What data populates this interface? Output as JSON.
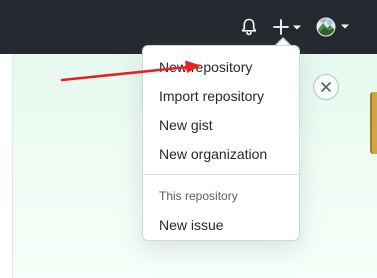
{
  "header": {
    "notifications_icon": "bell-icon",
    "create_icon": "plus-icon",
    "create_dropdown_icon": "caret-down-icon",
    "avatar_icon": "user-avatar",
    "avatar_dropdown_icon": "caret-down-icon"
  },
  "dropdown": {
    "items": [
      {
        "label": "New repository"
      },
      {
        "label": "Import repository"
      },
      {
        "label": "New gist"
      },
      {
        "label": "New organization"
      }
    ],
    "section_label": "This repository",
    "section_items": [
      {
        "label": "New issue"
      }
    ]
  },
  "banner": {
    "close_icon": "close-icon"
  },
  "annotation": {
    "arrow_color": "#e8211f",
    "points_to": "New repository"
  },
  "colors": {
    "header_bg": "#24292f",
    "banner_bg": "#e6f9ef",
    "text": "#24292f",
    "muted": "#57606a"
  }
}
